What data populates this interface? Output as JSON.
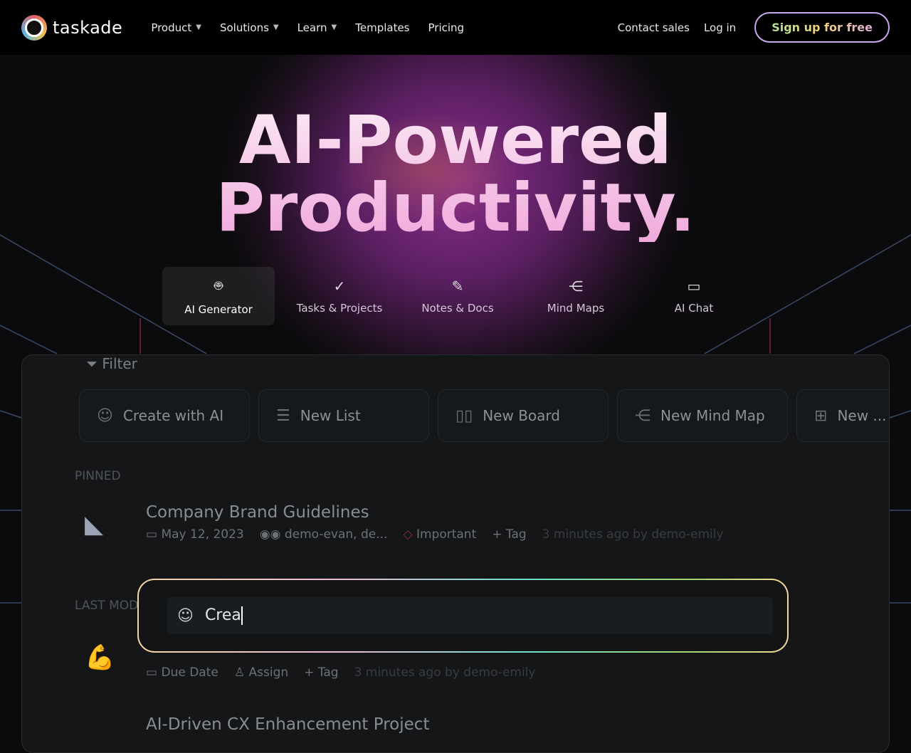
{
  "nav": {
    "brand": "taskade",
    "items": [
      {
        "label": "Product",
        "dropdown": true
      },
      {
        "label": "Solutions",
        "dropdown": true
      },
      {
        "label": "Learn",
        "dropdown": true
      },
      {
        "label": "Templates"
      },
      {
        "label": "Pricing"
      }
    ],
    "contact": "Contact sales",
    "login": "Log in",
    "signup": "Sign up for free"
  },
  "hero": {
    "line1": "AI-Powered",
    "line2": "Productivity."
  },
  "tabs": [
    {
      "label": "AI Generator",
      "icon": "robot-icon",
      "active": true
    },
    {
      "label": "Tasks & Projects",
      "icon": "check-circle-icon"
    },
    {
      "label": "Notes & Docs",
      "icon": "pencil-icon"
    },
    {
      "label": "Mind Maps",
      "icon": "share-nodes-icon"
    },
    {
      "label": "AI Chat",
      "icon": "video-icon"
    }
  ],
  "panel": {
    "filter": "Filter",
    "buttons": [
      {
        "label": "Create with AI",
        "icon": "robot-icon"
      },
      {
        "label": "New List",
        "icon": "list-icon"
      },
      {
        "label": "New Board",
        "icon": "board-icon"
      },
      {
        "label": "New Mind Map",
        "icon": "share-nodes-icon"
      },
      {
        "label": "New ...",
        "icon": "table-icon"
      }
    ],
    "pinned_label": "PINNED",
    "pinned": {
      "title": "Company Brand Guidelines",
      "date": "May 12, 2023",
      "members": "demo-evan, de...",
      "tag": "Important",
      "add_tag": "+ Tag",
      "updated": "3 minutes ago by demo-emily"
    },
    "last_label": "LAST MOD",
    "recent": {
      "due": "Due Date",
      "assign": "Assign",
      "add_tag": "+ Tag",
      "updated": "3 minutes ago by demo-emily"
    },
    "next_title": "AI-Driven CX Enhancement Project"
  },
  "prompt": {
    "value": "Crea"
  }
}
